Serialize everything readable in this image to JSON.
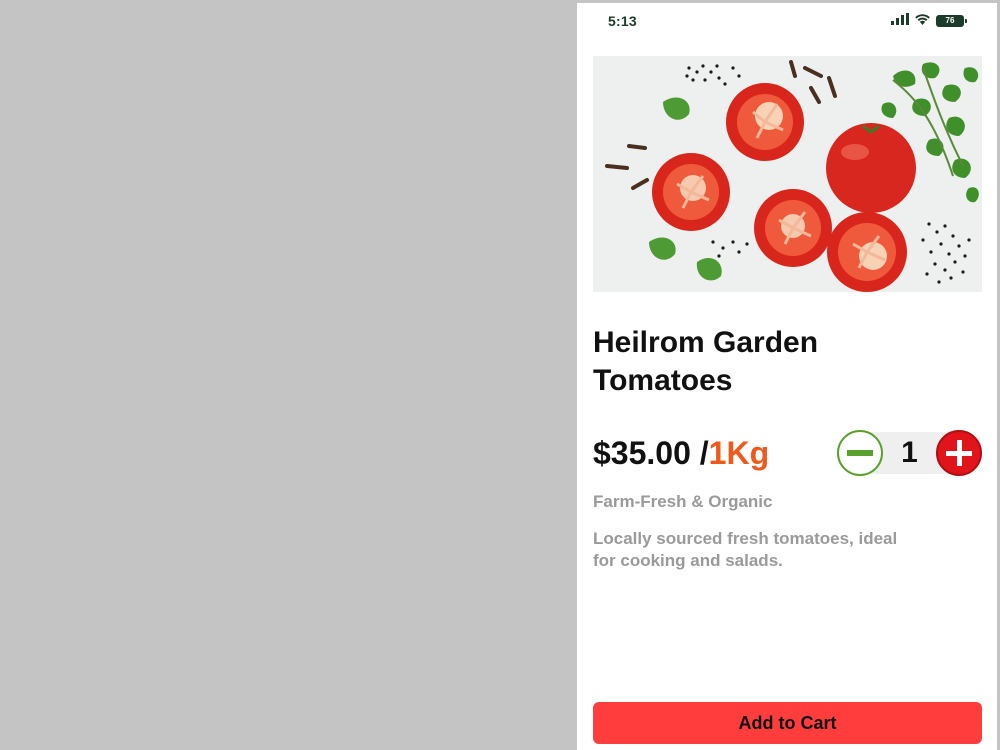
{
  "status_bar": {
    "time": "5:13",
    "battery": "76",
    "icons": [
      "signal-icon",
      "wifi-icon",
      "battery-icon"
    ]
  },
  "product": {
    "image_alt_icon": "tomatoes-photo",
    "title_line1": "Heilrom Garden",
    "title_line2": "Tomatoes",
    "price": "$35.00 /",
    "unit": "1Kg",
    "subtitle": "Farm-Fresh & Organic",
    "description_line1": "Locally sourced fresh tomatoes, ideal",
    "description_line2": "for cooking and salads."
  },
  "quantity": {
    "value": "1",
    "minus_icon": "minus-icon",
    "plus_icon": "plus-icon"
  },
  "cart": {
    "button_label": "Add to Cart"
  },
  "colors": {
    "accent_red": "#ff3d3d",
    "unit_orange": "#ef5a1c",
    "minus_green": "#5aa02c",
    "plus_red": "#e1141b",
    "status_green": "#1d3b2a"
  }
}
